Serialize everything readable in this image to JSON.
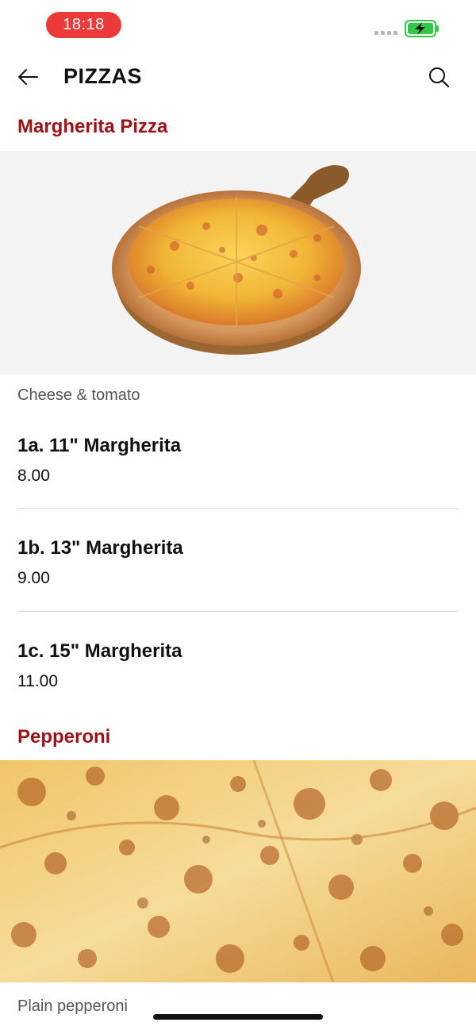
{
  "status": {
    "time": "18:18"
  },
  "header": {
    "title": "PIZZAS"
  },
  "sections": [
    {
      "title": "Margherita Pizza",
      "description": "Cheese & tomato",
      "items": [
        {
          "name": "1a. 11\" Margherita",
          "price": "8.00"
        },
        {
          "name": "1b. 13\" Margherita",
          "price": "9.00"
        },
        {
          "name": "1c. 15\" Margherita",
          "price": "11.00"
        }
      ]
    },
    {
      "title": "Pepperoni",
      "description": "Plain pepperoni"
    }
  ],
  "colors": {
    "accent": "#9b1116",
    "time_pill": "#ec3a3a",
    "battery": "#31c84a"
  }
}
